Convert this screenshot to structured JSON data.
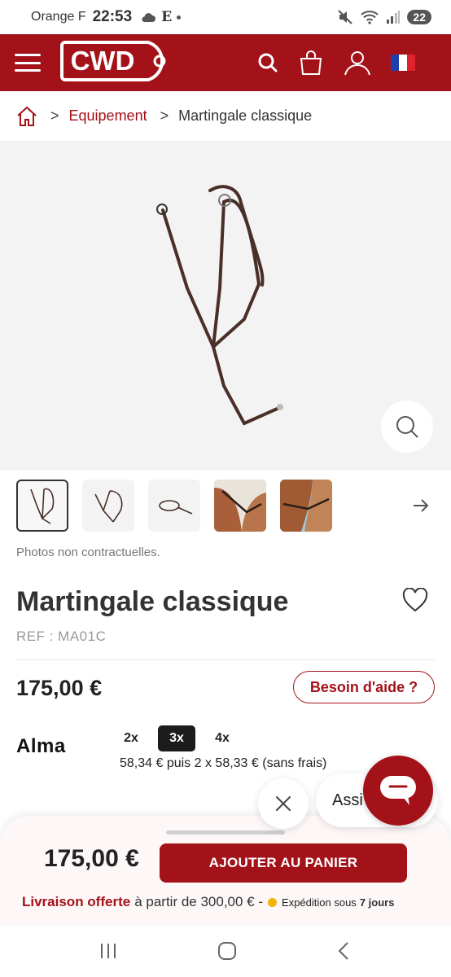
{
  "status_bar": {
    "carrier": "Orange F",
    "time": "22:53",
    "e_icon": "E",
    "battery": "22",
    "icons": [
      "cloud-icon",
      "mute-icon",
      "wifi-icon",
      "signal-icon"
    ]
  },
  "header": {
    "logo_text": "CWD",
    "icons": [
      "menu-icon",
      "search-icon",
      "bag-icon",
      "account-icon",
      "flag-fr-icon"
    ],
    "background": "#a41219"
  },
  "breadcrumb": {
    "sep": ">",
    "category": "Equipement",
    "current": "Martingale classique"
  },
  "gallery": {
    "thumb_count": 5,
    "active_index": 0
  },
  "product": {
    "disclaimer": "Photos non contractuelles.",
    "title": "Martingale classique",
    "ref": "REF : MA01C",
    "price": "175,00 €",
    "help_label": "Besoin d'aide ?"
  },
  "alma": {
    "logo": "Alma",
    "options": [
      "2x",
      "3x",
      "4x"
    ],
    "selected": "3x",
    "detail": "58,34 € puis 2 x 58,33 € (sans frais)"
  },
  "chat": {
    "label": "Assi"
  },
  "bottom_sheet": {
    "price": "175,00 €",
    "add_to_cart": "AJOUTER AU PANIER",
    "delivery_strong": "Livraison offerte",
    "delivery_text": "à partir de 300,00 € -",
    "shipping_text": "Expédition sous",
    "shipping_days": "7 jours"
  },
  "colors": {
    "brand": "#a41219",
    "shipping_dot": "#f2b400"
  }
}
